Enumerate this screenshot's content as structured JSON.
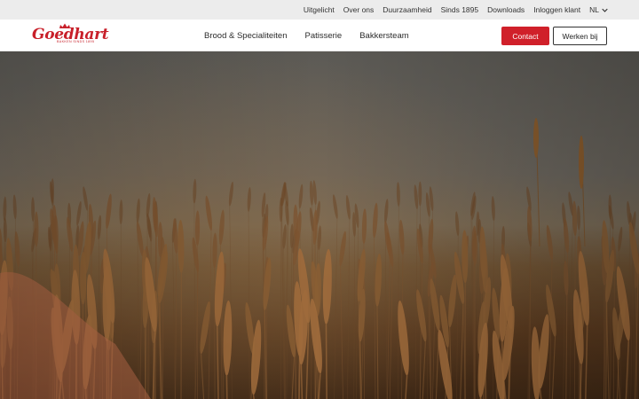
{
  "topbar": {
    "links": [
      "Uitgelicht",
      "Over ons",
      "Duurzaamheid",
      "Sinds 1895",
      "Downloads",
      "Inloggen klant"
    ],
    "language": "NL",
    "language_icon": "chevron-down-icon"
  },
  "brand": {
    "name": "Goedhart",
    "tagline": "BAKKEN SINDS 1895",
    "color": "#c8202a"
  },
  "nav": {
    "items": [
      "Brood & Specialiteiten",
      "Patisserie",
      "Bakkersteam"
    ],
    "contact_label": "Contact",
    "werken_label": "Werken bij",
    "accent": "#d0202a"
  },
  "hero": {
    "image": "wheat-field-photo"
  }
}
